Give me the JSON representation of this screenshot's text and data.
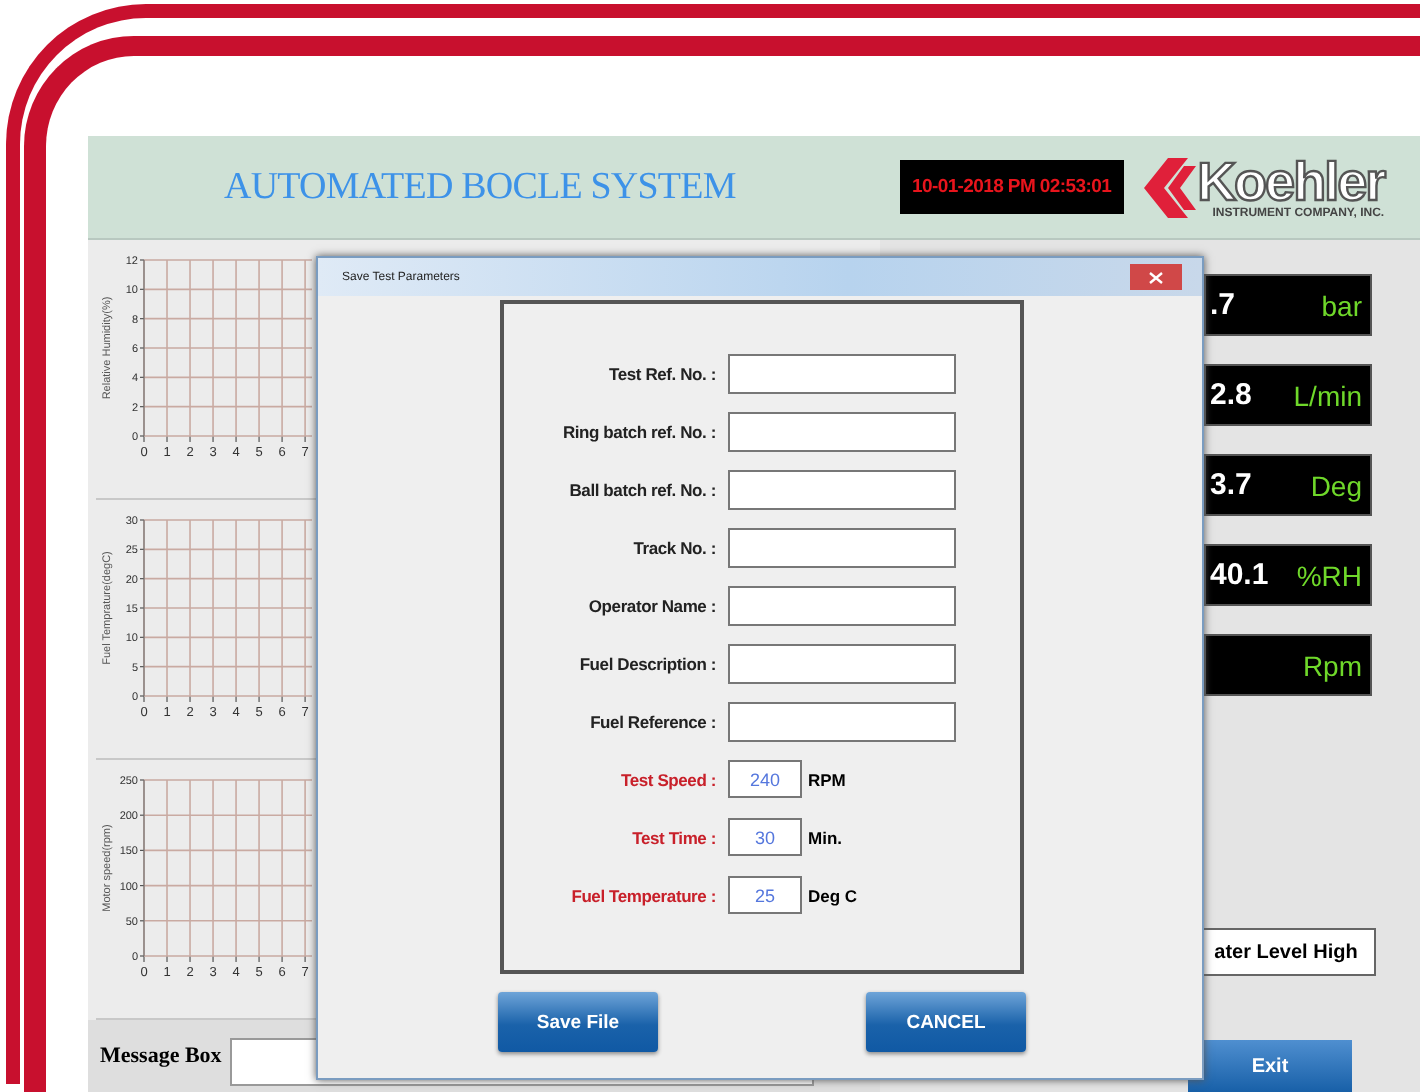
{
  "header": {
    "title": "AUTOMATED BOCLE SYSTEM",
    "clock": "10-01-2018 PM 02:53:01",
    "logo": {
      "name": "Koehler",
      "tagline": "INSTRUMENT COMPANY, INC."
    }
  },
  "charts": [
    {
      "chart_data": {
        "type": "line",
        "grid": true,
        "ylabel": "Relative Humidity(%)",
        "xlim": [
          0,
          7.3
        ],
        "ylim": [
          0,
          12
        ],
        "xticks": [
          0,
          1,
          2,
          3,
          4,
          5,
          6,
          7
        ],
        "yticks": [
          0,
          2,
          4,
          6,
          8,
          10,
          12
        ]
      }
    },
    {
      "chart_data": {
        "type": "line",
        "grid": true,
        "ylabel": "Fuel Temprature(degC)",
        "xlim": [
          0,
          7.3
        ],
        "ylim": [
          0,
          30
        ],
        "xticks": [
          0,
          1,
          2,
          3,
          4,
          5,
          6,
          7
        ],
        "yticks": [
          0,
          5,
          10,
          15,
          20,
          25,
          30
        ]
      }
    },
    {
      "chart_data": {
        "type": "line",
        "grid": true,
        "ylabel": "Motor speed(rpm)",
        "xlim": [
          0,
          7.3
        ],
        "ylim": [
          0,
          250
        ],
        "xticks": [
          0,
          1,
          2,
          3,
          4,
          5,
          6,
          7
        ],
        "yticks": [
          0,
          50,
          100,
          150,
          200,
          250
        ]
      }
    }
  ],
  "message_box": {
    "label": "Message Box"
  },
  "readouts": [
    {
      "value": ".7",
      "unit": "bar"
    },
    {
      "value": "2.8",
      "unit": "L/min"
    },
    {
      "value": "3.7",
      "unit": "Deg"
    },
    {
      "value": "40.1",
      "unit": "%RH"
    },
    {
      "unit": "Rpm"
    }
  ],
  "status": "ater Level High",
  "exit_button": "Exit",
  "dialog": {
    "title": "Save Test Parameters",
    "fields": [
      {
        "kind": "text",
        "label": "Test Ref. No. :"
      },
      {
        "kind": "text",
        "label": "Ring batch ref. No. :"
      },
      {
        "kind": "text",
        "label": "Ball batch ref. No. :"
      },
      {
        "kind": "text",
        "label": "Track No. :"
      },
      {
        "kind": "text",
        "label": "Operator Name :"
      },
      {
        "kind": "text",
        "label": "Fuel Description :"
      },
      {
        "kind": "text",
        "label": "Fuel Reference :"
      },
      {
        "kind": "number",
        "label": "Test Speed :",
        "value": "240",
        "unit": "RPM"
      },
      {
        "kind": "number",
        "label": "Test Time :",
        "value": "30",
        "unit": "Min."
      },
      {
        "kind": "number",
        "label": "Fuel Temperature :",
        "value": "25",
        "unit": "Deg C"
      }
    ],
    "buttons": [
      "Save File",
      "CANCEL"
    ]
  }
}
